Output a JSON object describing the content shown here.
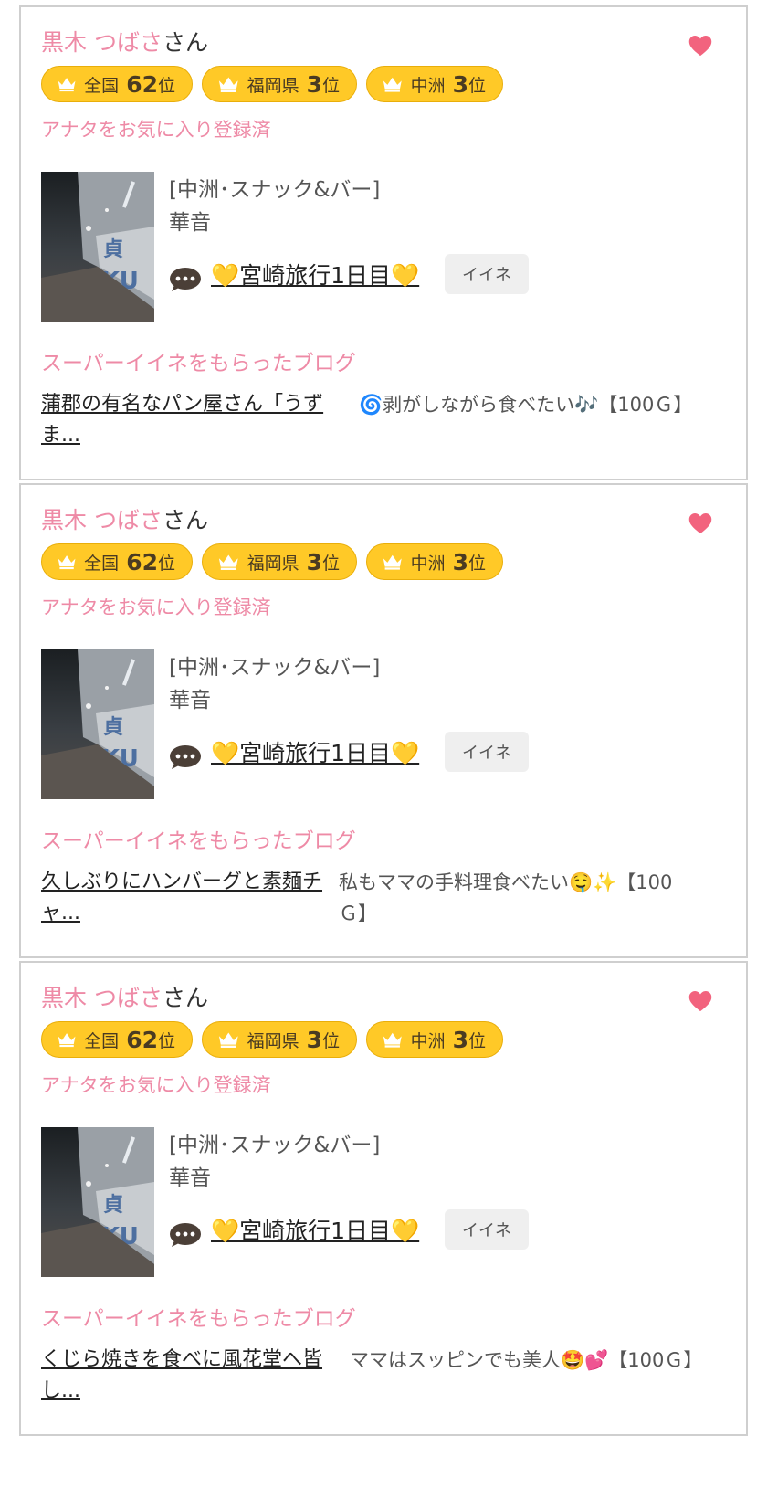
{
  "cards": [
    {
      "name": "黒木 つばさ",
      "honorific": "さん",
      "ranks": [
        {
          "area": "全国",
          "num": "62",
          "suffix": "位"
        },
        {
          "area": "福岡県",
          "num": "3",
          "suffix": "位"
        },
        {
          "area": "中洲",
          "num": "3",
          "suffix": "位"
        }
      ],
      "fav_status": "アナタをお気に入り登録済",
      "category": "[中洲･スナック&バー]",
      "shop": "華音",
      "blog_title": "💛宮崎旅行1日目💛",
      "iine_label": "イイネ",
      "super_label": "スーパーイイネをもらったブログ",
      "super_blog_link": "蒲郡の有名なパン屋さん「うずま...",
      "super_comment": "🌀剥がしながら食べたい🎶【100Ｇ】"
    },
    {
      "name": "黒木 つばさ",
      "honorific": "さん",
      "ranks": [
        {
          "area": "全国",
          "num": "62",
          "suffix": "位"
        },
        {
          "area": "福岡県",
          "num": "3",
          "suffix": "位"
        },
        {
          "area": "中洲",
          "num": "3",
          "suffix": "位"
        }
      ],
      "fav_status": "アナタをお気に入り登録済",
      "category": "[中洲･スナック&バー]",
      "shop": "華音",
      "blog_title": "💛宮崎旅行1日目💛",
      "iine_label": "イイネ",
      "super_label": "スーパーイイネをもらったブログ",
      "super_blog_link": "久しぶりにハンバーグと素麺チャ...",
      "super_comment": "私もママの手料理食べたい🤤✨【100Ｇ】"
    },
    {
      "name": "黒木 つばさ",
      "honorific": "さん",
      "ranks": [
        {
          "area": "全国",
          "num": "62",
          "suffix": "位"
        },
        {
          "area": "福岡県",
          "num": "3",
          "suffix": "位"
        },
        {
          "area": "中洲",
          "num": "3",
          "suffix": "位"
        }
      ],
      "fav_status": "アナタをお気に入り登録済",
      "category": "[中洲･スナック&バー]",
      "shop": "華音",
      "blog_title": "💛宮崎旅行1日目💛",
      "iine_label": "イイネ",
      "super_label": "スーパーイイネをもらったブログ",
      "super_blog_link": "くじら焼きを食べに風花堂へ皆し...",
      "super_comment": "ママはスッピンでも美人🤩💕【100Ｇ】"
    }
  ],
  "colors": {
    "accent_pink": "#ee8aa6",
    "heart": "#f2637e",
    "badge_gold": "#ffc927"
  },
  "icons": {
    "favorite": "heart-icon",
    "rank": "crown-icon",
    "comment": "speech-bubble-icon"
  }
}
